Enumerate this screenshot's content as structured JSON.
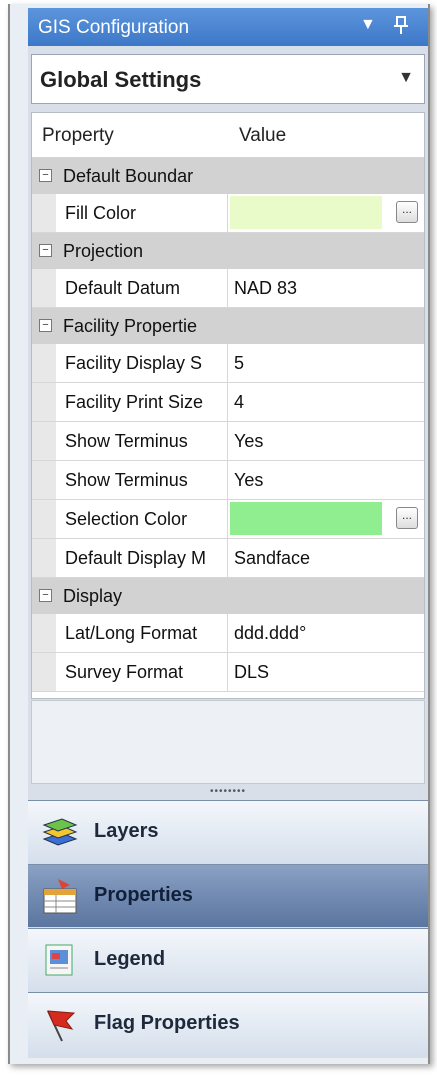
{
  "window": {
    "title": "GIS Configuration",
    "pin_icon": "pin-icon",
    "menu_icon": "dropdown-arrow-icon"
  },
  "dropdown": {
    "selected": "Global Settings"
  },
  "grid": {
    "headers": {
      "property": "Property",
      "value": "Value"
    },
    "categories": [
      {
        "label": "Default Boundar",
        "toggle": "−"
      },
      {
        "label": "Projection",
        "toggle": "−"
      },
      {
        "label": "Facility Propertie",
        "toggle": "−"
      },
      {
        "label": "Display",
        "toggle": "−"
      }
    ],
    "rows": [
      {
        "label": "Fill Color",
        "value": "",
        "color": "#e8fbc8"
      },
      {
        "label": "Default Datum",
        "value": "NAD 83"
      },
      {
        "label": "Facility Display S",
        "value": "5"
      },
      {
        "label": "Facility Print Size",
        "value": "4"
      },
      {
        "label": "Show Terminus",
        "value": "Yes"
      },
      {
        "label": "Show Terminus",
        "value": "Yes"
      },
      {
        "label": "Selection Color",
        "value": "",
        "color": "#90ee90"
      },
      {
        "label": "Default Display M",
        "value": "Sandface"
      },
      {
        "label": "Lat/Long Format",
        "value": "ddd.ddd°"
      },
      {
        "label": "Survey Format",
        "value": "DLS"
      }
    ],
    "ellipsis": "..."
  },
  "nav": [
    {
      "label": "Layers",
      "icon": "layers-icon",
      "active": false
    },
    {
      "label": "Properties",
      "icon": "properties-icon",
      "active": true
    },
    {
      "label": "Legend",
      "icon": "legend-icon",
      "active": false
    },
    {
      "label": "Flag Properties",
      "icon": "flag-icon",
      "active": false
    }
  ],
  "colors": {
    "titlebar": "#4a86d2",
    "active_nav": "#6d86ad"
  }
}
